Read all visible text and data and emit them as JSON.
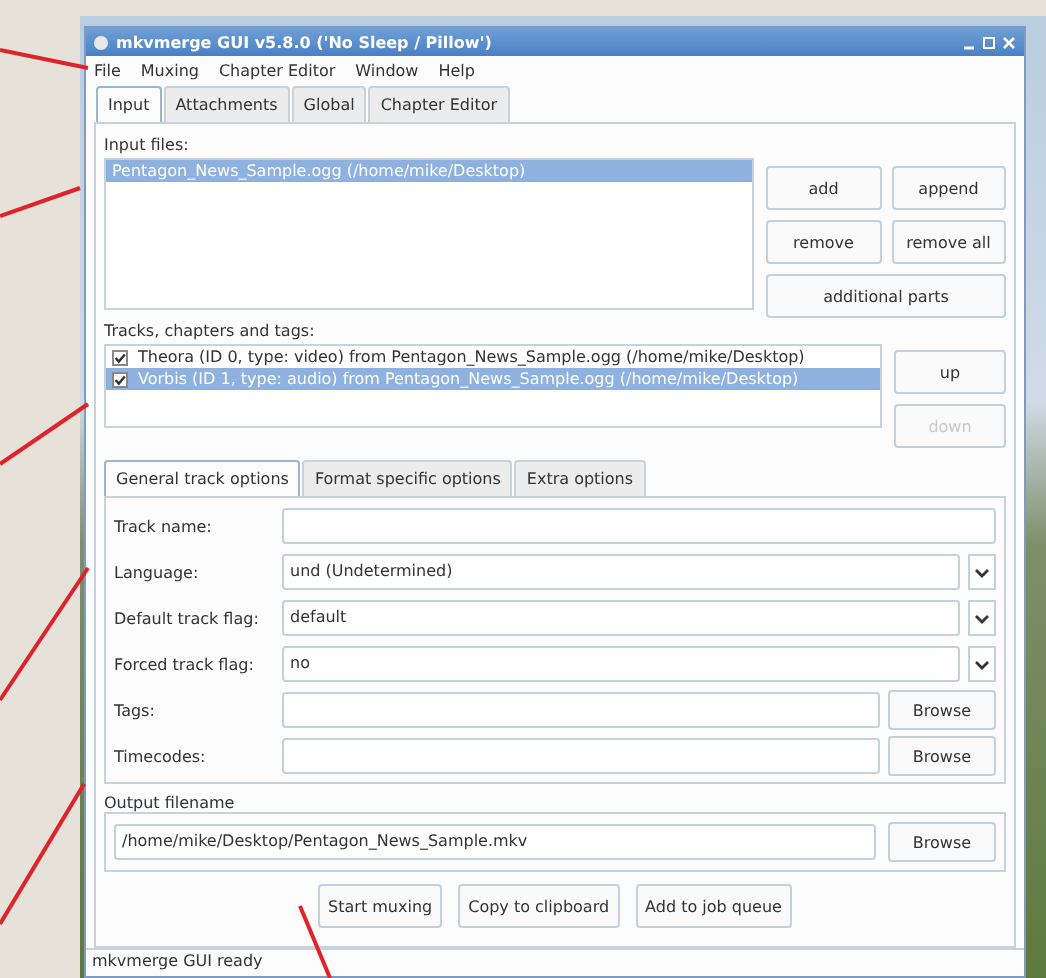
{
  "window": {
    "title": "mkvmerge GUI v5.8.0 ('No Sleep / Pillow')"
  },
  "menu": [
    "File",
    "Muxing",
    "Chapter Editor",
    "Window",
    "Help"
  ],
  "tabs": [
    {
      "label": "Input",
      "selected": true
    },
    {
      "label": "Attachments",
      "selected": false
    },
    {
      "label": "Global",
      "selected": false
    },
    {
      "label": "Chapter Editor",
      "selected": false
    }
  ],
  "input_files": {
    "label": "Input files:",
    "items": [
      {
        "text": "Pentagon_News_Sample.ogg (/home/mike/Desktop)",
        "selected": true
      }
    ],
    "buttons": [
      "add",
      "append",
      "remove",
      "remove all",
      "additional parts"
    ]
  },
  "tracks": {
    "label": "Tracks, chapters and tags:",
    "items": [
      {
        "text": "Theora (ID 0, type: video) from Pentagon_News_Sample.ogg (/home/mike/Desktop)",
        "checked": true,
        "selected": false
      },
      {
        "text": "Vorbis (ID 1, type: audio) from Pentagon_News_Sample.ogg (/home/mike/Desktop)",
        "checked": true,
        "selected": true
      }
    ],
    "buttons": [
      {
        "label": "up",
        "disabled": false
      },
      {
        "label": "down",
        "disabled": true
      }
    ]
  },
  "subtabs": [
    {
      "label": "General track options",
      "selected": true
    },
    {
      "label": "Format specific options",
      "selected": false
    },
    {
      "label": "Extra options",
      "selected": false
    }
  ],
  "fields": [
    {
      "kind": "text",
      "label": "Track name:"
    },
    {
      "kind": "combo",
      "label": "Language:",
      "value": "und (Undetermined)"
    },
    {
      "kind": "combo",
      "label": "Default track flag:",
      "value": "default"
    },
    {
      "kind": "combo",
      "label": "Forced track flag:",
      "value": "no"
    },
    {
      "kind": "file",
      "label": "Tags:",
      "button": "Browse"
    },
    {
      "kind": "file",
      "label": "Timecodes:",
      "button": "Browse"
    }
  ],
  "output": {
    "label": "Output filename",
    "value": "/home/mike/Desktop/Pentagon_News_Sample.mkv",
    "button": "Browse"
  },
  "actions": [
    "Start muxing",
    "Copy to clipboard",
    "Add to job queue"
  ],
  "status_bar": "mkvmerge GUI ready"
}
